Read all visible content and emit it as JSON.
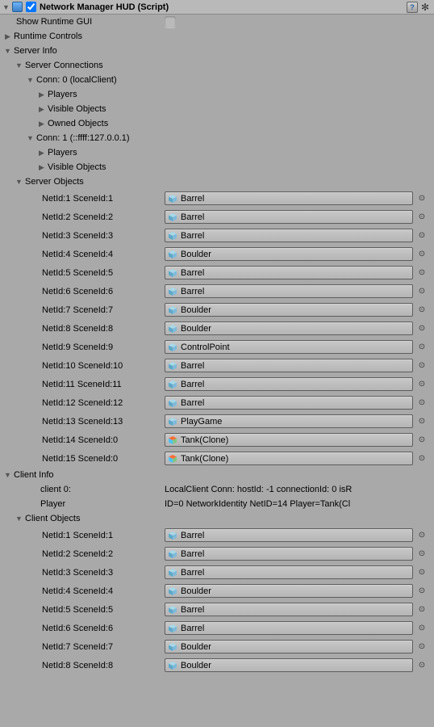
{
  "component": {
    "title": "Network Manager HUD (Script)",
    "enabled": true
  },
  "showRuntimeGUI": {
    "label": "Show Runtime GUI",
    "checked": false
  },
  "runtimeControls": {
    "label": "Runtime Controls"
  },
  "serverInfo": {
    "label": "Server Info",
    "connections": {
      "label": "Server Connections",
      "items": [
        {
          "label": "Conn: 0 (localClient)",
          "children": [
            "Players",
            "Visible Objects",
            "Owned Objects"
          ],
          "expanded": true
        },
        {
          "label": "Conn: 1 (::ffff:127.0.0.1)",
          "children": [
            "Players",
            "Visible Objects"
          ],
          "expanded": true
        }
      ]
    },
    "objects": {
      "label": "Server Objects",
      "items": [
        {
          "netId": 1,
          "sceneId": 1,
          "name": "Barrel",
          "prefab": false
        },
        {
          "netId": 2,
          "sceneId": 2,
          "name": "Barrel",
          "prefab": false
        },
        {
          "netId": 3,
          "sceneId": 3,
          "name": "Barrel",
          "prefab": false
        },
        {
          "netId": 4,
          "sceneId": 4,
          "name": "Boulder",
          "prefab": false
        },
        {
          "netId": 5,
          "sceneId": 5,
          "name": "Barrel",
          "prefab": false
        },
        {
          "netId": 6,
          "sceneId": 6,
          "name": "Barrel",
          "prefab": false
        },
        {
          "netId": 7,
          "sceneId": 7,
          "name": "Boulder",
          "prefab": false
        },
        {
          "netId": 8,
          "sceneId": 8,
          "name": "Boulder",
          "prefab": false
        },
        {
          "netId": 9,
          "sceneId": 9,
          "name": "ControlPoint",
          "prefab": false
        },
        {
          "netId": 10,
          "sceneId": 10,
          "name": "Barrel",
          "prefab": false
        },
        {
          "netId": 11,
          "sceneId": 11,
          "name": "Barrel",
          "prefab": false
        },
        {
          "netId": 12,
          "sceneId": 12,
          "name": "Barrel",
          "prefab": false
        },
        {
          "netId": 13,
          "sceneId": 13,
          "name": "PlayGame",
          "prefab": false
        },
        {
          "netId": 14,
          "sceneId": 0,
          "name": "Tank(Clone)",
          "prefab": true
        },
        {
          "netId": 15,
          "sceneId": 0,
          "name": "Tank(Clone)",
          "prefab": true
        }
      ]
    }
  },
  "clientInfo": {
    "label": "Client Info",
    "client0Label": "client 0:",
    "client0Value": "LocalClient Conn: hostId: -1 connectionId: 0 isR",
    "playerLabel": "Player",
    "playerValue": "ID=0 NetworkIdentity NetID=14 Player=Tank(Cl",
    "objects": {
      "label": "Client Objects",
      "items": [
        {
          "netId": 1,
          "sceneId": 1,
          "name": "Barrel",
          "prefab": false
        },
        {
          "netId": 2,
          "sceneId": 2,
          "name": "Barrel",
          "prefab": false
        },
        {
          "netId": 3,
          "sceneId": 3,
          "name": "Barrel",
          "prefab": false
        },
        {
          "netId": 4,
          "sceneId": 4,
          "name": "Boulder",
          "prefab": false
        },
        {
          "netId": 5,
          "sceneId": 5,
          "name": "Barrel",
          "prefab": false
        },
        {
          "netId": 6,
          "sceneId": 6,
          "name": "Barrel",
          "prefab": false
        },
        {
          "netId": 7,
          "sceneId": 7,
          "name": "Boulder",
          "prefab": false
        },
        {
          "netId": 8,
          "sceneId": 8,
          "name": "Boulder",
          "prefab": false
        }
      ]
    }
  }
}
